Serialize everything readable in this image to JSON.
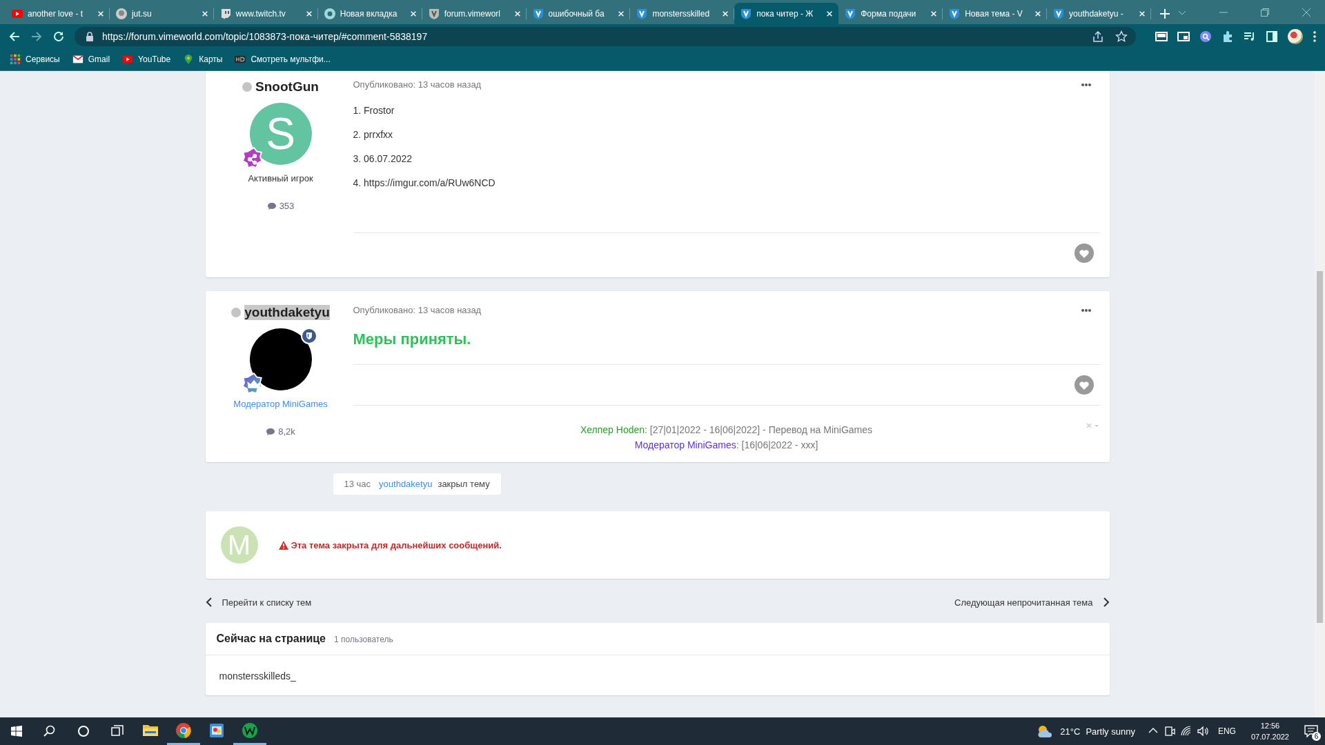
{
  "browser": {
    "tabs": [
      {
        "title": "another love - t",
        "selected": false
      },
      {
        "title": "jut.su",
        "selected": false
      },
      {
        "title": "www.twitch.tv",
        "selected": false
      },
      {
        "title": "Новая вкладка",
        "selected": false
      },
      {
        "title": "forum.vimeworl",
        "selected": false
      },
      {
        "title": "ошибочный ба",
        "selected": false
      },
      {
        "title": "monstersskilled",
        "selected": false
      },
      {
        "title": "пока читер - Ж",
        "selected": true
      },
      {
        "title": "Форма подачи",
        "selected": false
      },
      {
        "title": "Новая тема - V",
        "selected": false
      },
      {
        "title": "youthdaketyu - ",
        "selected": false
      }
    ],
    "address": "https://forum.vimeworld.com/topic/1083873-пока-читер/#comment-5838197",
    "bookmarks": [
      {
        "label": "Сервисы"
      },
      {
        "label": "Gmail"
      },
      {
        "label": "YouTube"
      },
      {
        "label": "Карты"
      },
      {
        "label": "Смотреть мультфи..."
      }
    ]
  },
  "posts": [
    {
      "author": "SnootGun",
      "online": false,
      "highlighted": false,
      "avatar": {
        "kind": "letter",
        "letter": "S",
        "color": "#62c4a0"
      },
      "rank": "Активный игрок",
      "count": "353",
      "published": "Опубликовано: 13 часов назад",
      "body": [
        {
          "kind": "paragraph",
          "text": "1.  Frostor"
        },
        {
          "kind": "paragraph",
          "text": "2.  prrxfxx"
        },
        {
          "kind": "paragraph",
          "text": "3. 06.07.2022"
        },
        {
          "kind": "paragraph",
          "text": "4. https://imgur.com/a/RUw6NCD"
        }
      ]
    },
    {
      "author": "youthdaketyu",
      "online": false,
      "highlighted": true,
      "avatar": {
        "kind": "dark"
      },
      "rank": "Модератор MiniGames",
      "count": "8,2k",
      "published": "Опубликовано: 13 часов назад",
      "body": [
        {
          "kind": "headline",
          "text": "Меры приняты."
        }
      ],
      "signature": [
        {
          "role": "Хелпер Hoden",
          "color": "#2a9d2a",
          "text": ": [27|01|2022 - 16|06|2022] - Перевод на MiniGames"
        },
        {
          "role": "Модератор MiniGames",
          "color": "#5b2cf5",
          "text": ": [16|06|2022 - xxx]"
        }
      ]
    }
  ],
  "event": {
    "time": "13 час",
    "user": "youthdaketyu",
    "action": "закрыл тему"
  },
  "closed": {
    "letter": "M",
    "color": "#cbe3b4",
    "message": "Эта тема закрыта для дальнейших сообщений."
  },
  "nav": {
    "prev": "Перейти к списку тем",
    "next": "Следующая непрочитанная тема"
  },
  "online": {
    "title": "Сейчас на странице",
    "count": "1 пользователь",
    "users": [
      "monstersskilleds_"
    ]
  },
  "taskbar": {
    "apps": [
      {
        "active": false
      },
      {
        "active": true
      },
      {
        "active": false
      },
      {
        "active": true
      }
    ],
    "temp": "21°C",
    "weather": "Partly sunny",
    "lang": "ENG",
    "time": "12:56",
    "date": "07.07.2022",
    "notifications": "6"
  }
}
